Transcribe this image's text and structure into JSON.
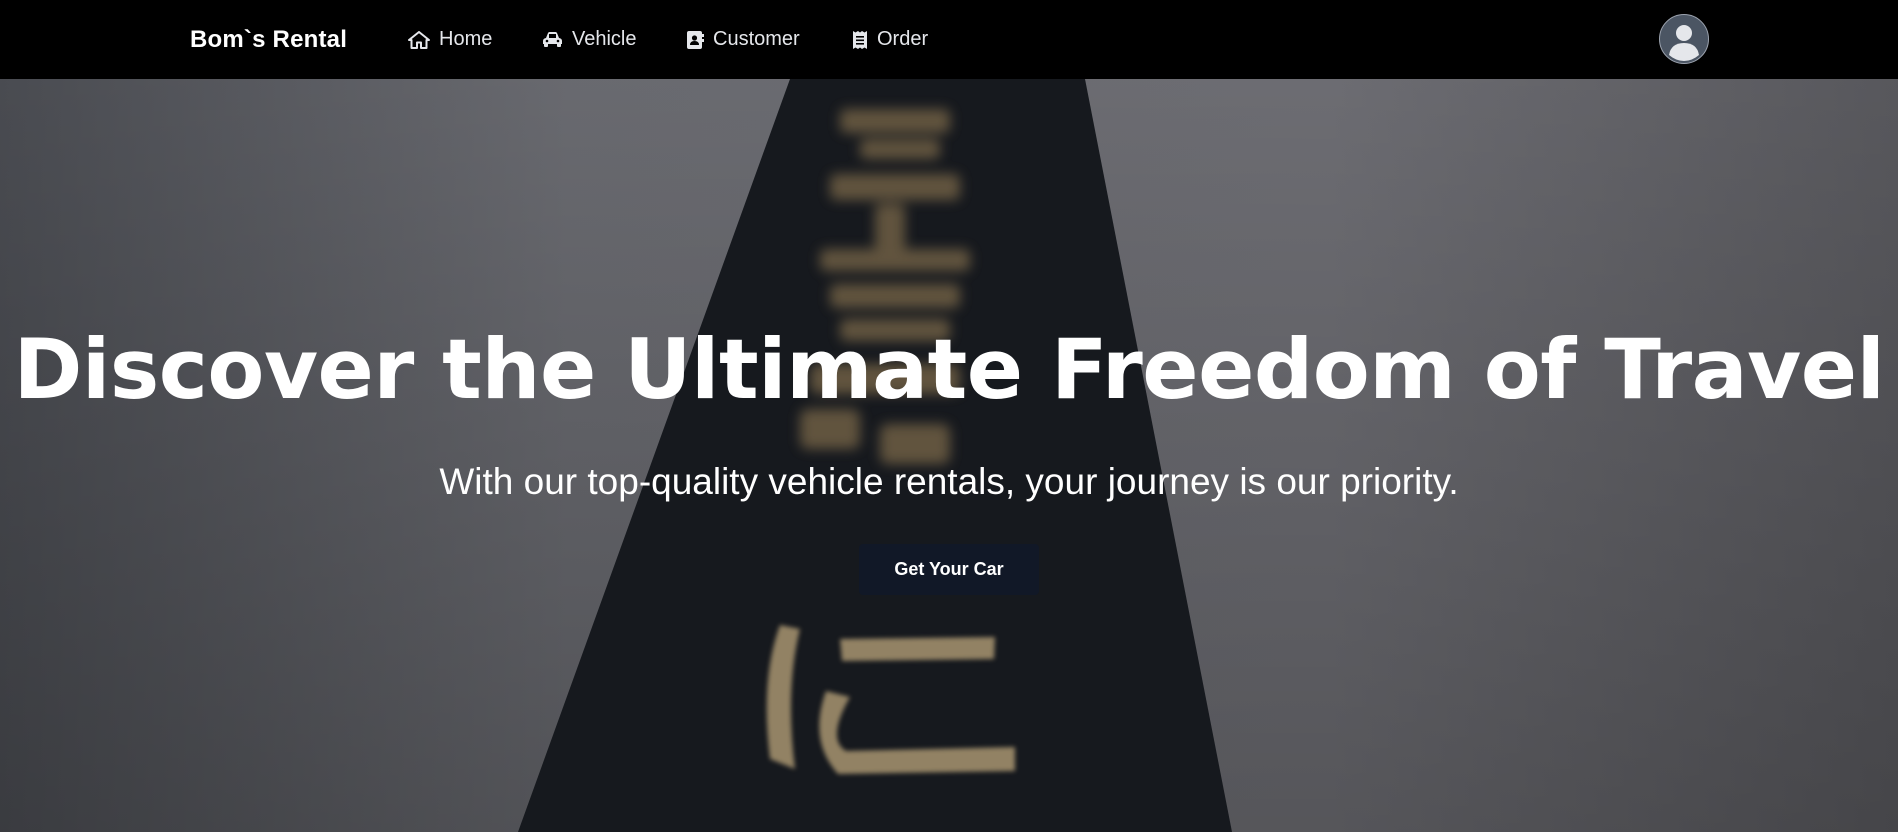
{
  "navbar": {
    "brand": "Bom`s Rental",
    "items": [
      {
        "label": "Home",
        "icon": "home-icon"
      },
      {
        "label": "Vehicle",
        "icon": "car-icon"
      },
      {
        "label": "Customer",
        "icon": "address-book-icon"
      },
      {
        "label": "Order",
        "icon": "receipt-icon"
      }
    ],
    "avatar_icon": "user-avatar-icon"
  },
  "hero": {
    "title": "Discover the Ultimate Freedom of Travel",
    "subtitle": "With our top-quality vehicle rentals, your journey is our priority.",
    "cta_label": "Get Your Car",
    "background_glyphs": [
      "に"
    ]
  },
  "colors": {
    "navbar_bg": "#000000",
    "cta_bg": "#111827",
    "text": "#ffffff",
    "hero_overlay": "#6b6b70"
  }
}
